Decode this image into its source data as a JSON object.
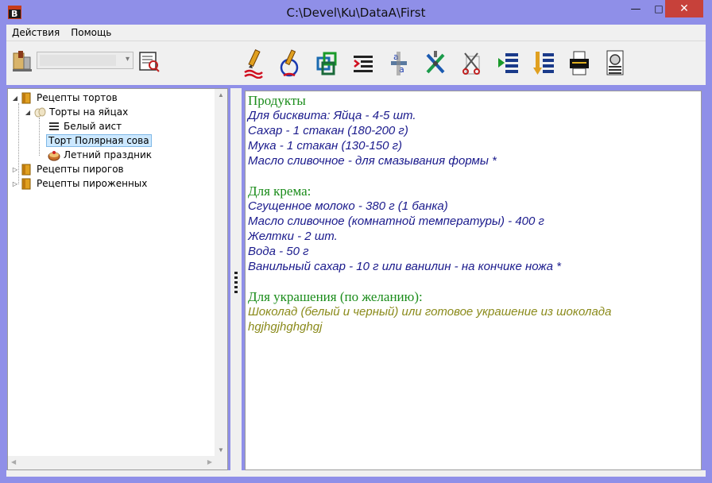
{
  "window": {
    "title": "C:\\Devel\\Ku\\DataA\\First",
    "app_icon_letter": "B",
    "minimize_glyph": "—",
    "maximize_glyph": "□",
    "close_glyph": "✕"
  },
  "menu": {
    "items": [
      {
        "label": "Действия"
      },
      {
        "label": "Помощь"
      }
    ]
  },
  "toolbar": {
    "combo_value": "",
    "combo_arrow": "▾",
    "buttons": [
      {
        "icon": "edit-pen-icon"
      },
      {
        "icon": "edit-circle-icon"
      },
      {
        "icon": "link-squares-icon"
      },
      {
        "icon": "text-lines-icon"
      },
      {
        "icon": "text-sort-icon"
      },
      {
        "icon": "tools-icon"
      },
      {
        "icon": "scissors-icon"
      },
      {
        "icon": "list-green-icon"
      },
      {
        "icon": "list-orange-icon"
      },
      {
        "icon": "printer-icon"
      },
      {
        "icon": "preview-icon"
      }
    ]
  },
  "tree": {
    "nodes": [
      {
        "label": "Рецепты тортов",
        "toggle": "◢",
        "icon": "book-icon",
        "selected": false
      },
      {
        "label": "Торты на яйцах",
        "toggle": "◢",
        "icon": "eggs-icon",
        "selected": false
      },
      {
        "label": "Белый аист",
        "toggle": "",
        "icon": "document-icon",
        "selected": false
      },
      {
        "label": "Торт Полярная сова",
        "toggle": "",
        "icon": "",
        "selected": true
      },
      {
        "label": "Летний праздник",
        "toggle": "",
        "icon": "cake-icon",
        "selected": false
      },
      {
        "label": "Рецепты пирогов",
        "toggle": "▷",
        "icon": "book-icon",
        "selected": false
      },
      {
        "label": "Рецепты пироженных",
        "toggle": "▷",
        "icon": "book-icon",
        "selected": false
      }
    ],
    "scroll_up": "▲",
    "scroll_down": "▼",
    "scroll_left": "◀",
    "scroll_right": "▶"
  },
  "content": {
    "sections": [
      {
        "heading": "Продукты",
        "style": "item",
        "lines": [
          "Для бисквита: Яйца - 4-5 шт.",
          "Сахар - 1 стакан (180-200 г)",
          "Мука - 1 стакан (130-150 г)",
          "Масло сливочное - для смазывания формы *"
        ]
      },
      {
        "heading": "Для крема:",
        "style": "item",
        "lines": [
          "Сгущенное молоко - 380 г (1 банка)",
          "Масло сливочное (комнатной температуры) - 400 г",
          "Желтки - 2 шт.",
          "Вода - 50 г",
          "Ванильный сахар - 10 г или ванилин - на кончике ножа *"
        ]
      },
      {
        "heading": "Для украшения (по желанию):",
        "style": "deco",
        "lines": [
          "Шоколад (белый и черный) или готовое украшение из шоколада",
          "hgjhgjhghghgj"
        ]
      }
    ]
  },
  "colors": {
    "heading": "#1a8c1a",
    "item": "#1a1a8c",
    "deco": "#8a8a1a",
    "window_frame": "#8f8fe8"
  }
}
